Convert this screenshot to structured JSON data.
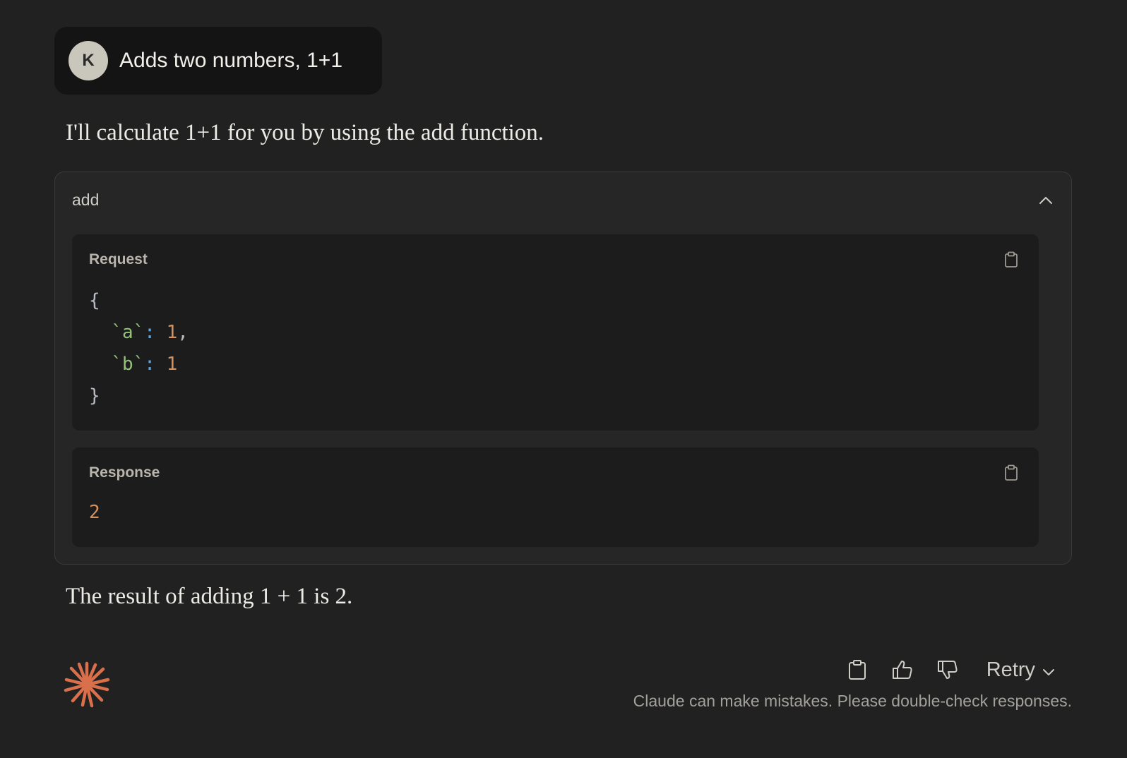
{
  "user_message": {
    "avatar_initial": "K",
    "text": "Adds two numbers, 1+1"
  },
  "assistant": {
    "intro_text": "I'll calculate 1+1 for you by using the add function.",
    "result_text": "The result of adding 1 + 1 is 2."
  },
  "tool_call": {
    "name": "add",
    "collapse_icon": "chevron-up-icon",
    "request": {
      "title": "Request",
      "copy_icon": "clipboard-icon",
      "open_brace": "{",
      "close_brace": "}",
      "params": [
        {
          "key": "`a`",
          "colon": ":",
          "value": "1",
          "trailing": ","
        },
        {
          "key": "`b`",
          "colon": ":",
          "value": "1",
          "trailing": ""
        }
      ]
    },
    "response": {
      "title": "Response",
      "copy_icon": "clipboard-icon",
      "value": "2"
    }
  },
  "footer": {
    "logo_icon": "claude-starburst-icon",
    "retry_label": "Retry",
    "disclaimer": "Claude can make mistakes. Please double-check responses."
  },
  "colors": {
    "background": "#212121",
    "bubble": "#141414",
    "card": "#262626",
    "panel": "#1c1c1c",
    "accent_logo": "#d9704b",
    "code_key": "#93c27a",
    "code_colon": "#5aa9e6",
    "code_number": "#d6925c"
  }
}
